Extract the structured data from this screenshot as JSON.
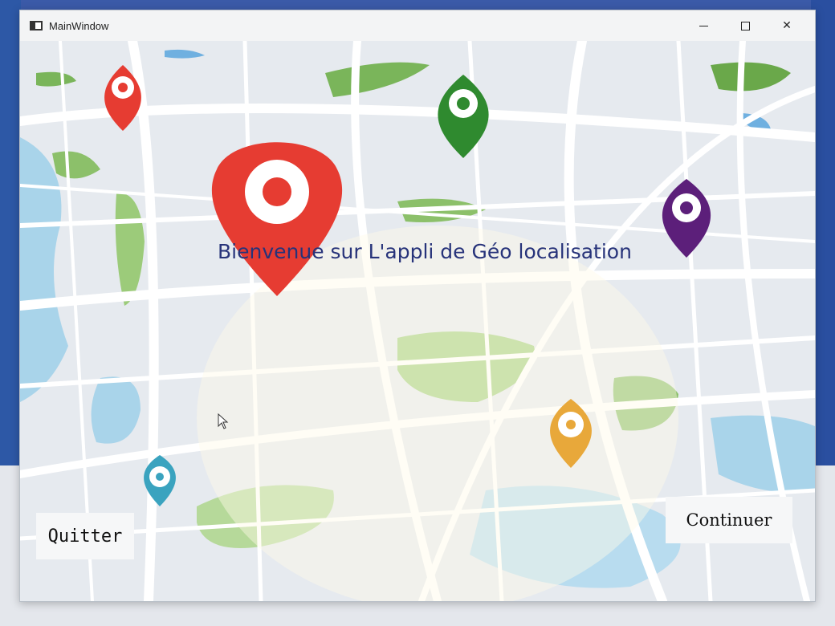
{
  "window": {
    "title": "MainWindow",
    "controls": {
      "minimize": "minimize-icon",
      "maximize": "maximize-icon",
      "close": "close-icon"
    }
  },
  "main": {
    "welcome_text": "Bienvenue sur L'appli de Géo localisation",
    "background": "city-map-illustration",
    "markers": [
      {
        "name": "red-marker-large",
        "color": "#e63c32"
      },
      {
        "name": "red-marker-small",
        "color": "#e63c32"
      },
      {
        "name": "green-marker",
        "color": "#2f8a2f"
      },
      {
        "name": "purple-marker",
        "color": "#5c1f7a"
      },
      {
        "name": "orange-marker",
        "color": "#e8a83a"
      },
      {
        "name": "teal-marker",
        "color": "#3aa3bf"
      }
    ]
  },
  "buttons": {
    "quit_label": "Quitter",
    "continue_label": "Continuer"
  },
  "colors": {
    "water": "#a9d4ea",
    "park": "#8cc06a",
    "road": "#ffffff",
    "land": "#e6eaef",
    "text": "#27337a"
  }
}
